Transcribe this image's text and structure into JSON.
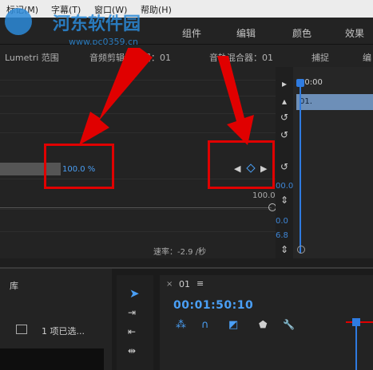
{
  "menu": [
    "标记(M)",
    "字幕(T)",
    "窗口(W)",
    "帮助(H)"
  ],
  "workspaces": [
    "组件",
    "编辑",
    "颜色",
    "效果"
  ],
  "panel_tabs": [
    "Lumetri 范围",
    "音频剪辑混合器：01",
    "音轨混合器：01",
    "捕捉",
    "编"
  ],
  "watermark": {
    "title": "河东软件园",
    "url": "www.pc0359.cn"
  },
  "effect": {
    "value": "100.0 %",
    "scale_max": "100.0",
    "upper_value": "00.0",
    "lower_value1": "0.0",
    "lower_value2": "6.8",
    "rate_label": "速率：-2.9 /秒"
  },
  "timeline": {
    "ruler_time": "00:00",
    "clip_label": "01."
  },
  "library": {
    "title": "库",
    "selection": "1 项已选..."
  },
  "sequence": {
    "tab": "01",
    "timecode": "00:01:50:10"
  },
  "colors": {
    "accent": "#2f7be0",
    "annotation": "#e00000"
  }
}
